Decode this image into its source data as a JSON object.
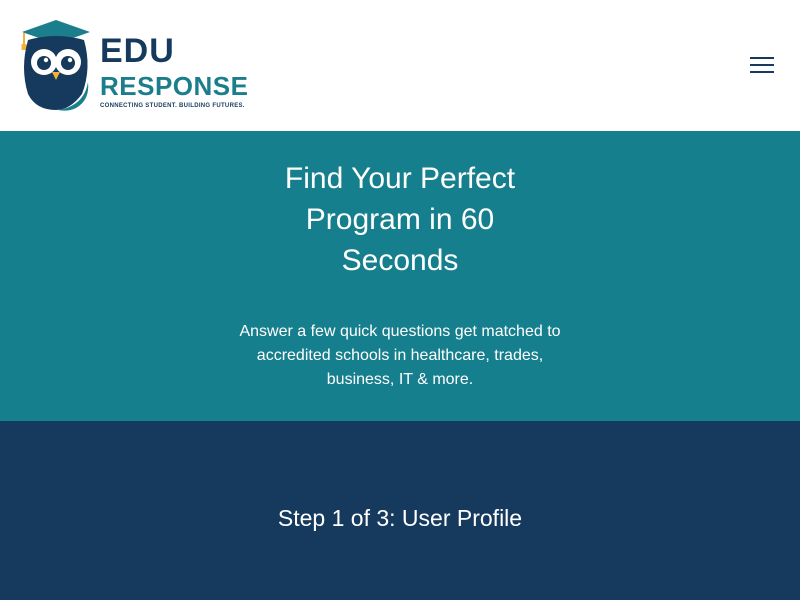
{
  "header": {
    "logo": {
      "word1": "EDU",
      "word2": "RESPONSE",
      "tagline": "CONNECTING STUDENT. BUILDING FUTURES."
    },
    "menu_icon": "hamburger-menu-icon"
  },
  "hero": {
    "title": "Find Your Perfect Program in 60 Seconds",
    "subtitle": "Answer a few quick questions get matched to accredited schools in healthcare, trades, business, IT & more."
  },
  "form": {
    "step_title": "Step 1 of 3: User Profile"
  },
  "colors": {
    "navy": "#163a5e",
    "teal": "#167f8e",
    "accent_yellow": "#f2b233",
    "white": "#ffffff"
  }
}
